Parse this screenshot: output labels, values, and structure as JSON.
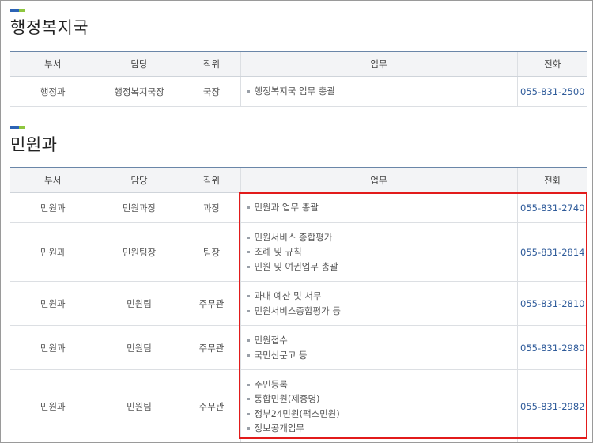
{
  "colors": {
    "highlight": "#e21b1b",
    "phone": "#2f5b9a",
    "header_rule": "#6a86a8",
    "mark_blue": "#2c63b5",
    "mark_green": "#8ec63f"
  },
  "sections": [
    {
      "title": "행정복지국",
      "headers": [
        "부서",
        "담당",
        "직위",
        "업무",
        "전화"
      ],
      "rows": [
        {
          "dept": "행정과",
          "role": "행정복지국장",
          "position": "국장",
          "duties": [
            "행정복지국 업무 총괄"
          ],
          "phone": "055-831-2500"
        }
      ]
    },
    {
      "title": "민원과",
      "headers": [
        "부서",
        "담당",
        "직위",
        "업무",
        "전화"
      ],
      "rows": [
        {
          "dept": "민원과",
          "role": "민원과장",
          "position": "과장",
          "duties": [
            "민원과 업무 총괄"
          ],
          "phone": "055-831-2740"
        },
        {
          "dept": "민원과",
          "role": "민원팀장",
          "position": "팀장",
          "duties": [
            "민원서비스 종합평가",
            "조례 및 규칙",
            "민원 및 여권업무 총괄"
          ],
          "phone": "055-831-2814"
        },
        {
          "dept": "민원과",
          "role": "민원팀",
          "position": "주무관",
          "duties": [
            "과내 예산 및 서무",
            "민원서비스종합평가 등"
          ],
          "phone": "055-831-2810"
        },
        {
          "dept": "민원과",
          "role": "민원팀",
          "position": "주무관",
          "duties": [
            "민원접수",
            "국민신문고 등"
          ],
          "phone": "055-831-2980"
        },
        {
          "dept": "민원과",
          "role": "민원팀",
          "position": "주무관",
          "duties": [
            "주민등록",
            "통합민원(제증명)",
            "정부24민원(팩스민원)",
            "정보공개업무"
          ],
          "phone": "055-831-2982"
        }
      ]
    }
  ]
}
